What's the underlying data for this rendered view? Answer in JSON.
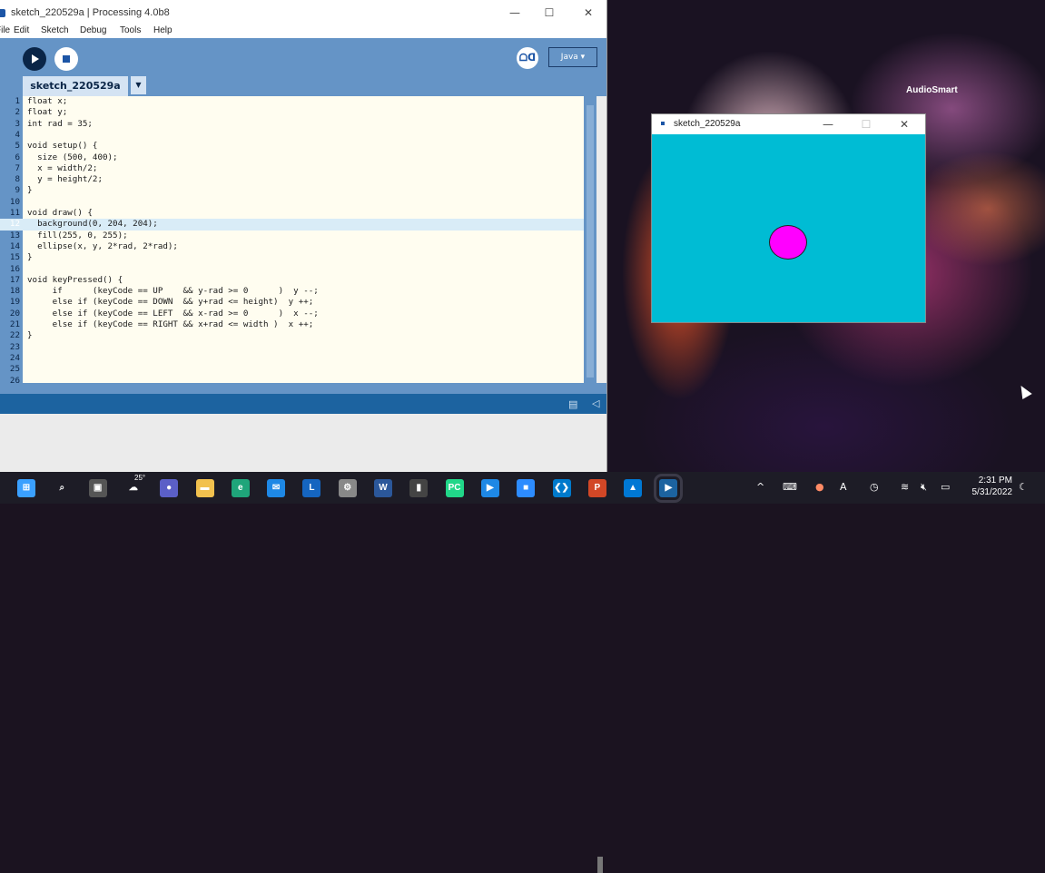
{
  "ide": {
    "title": "sketch_220529a | Processing 4.0b8",
    "menu": [
      "File",
      "Edit",
      "Sketch",
      "Debug",
      "Tools",
      "Help"
    ],
    "mode": "Java ▾",
    "debug_label": "ᗝᗡ",
    "tab_name": "sketch_220529a",
    "tab_menu": "▼"
  },
  "code": [
    {
      "n": "1",
      "t": "float x;"
    },
    {
      "n": "2",
      "t": "float y;"
    },
    {
      "n": "3",
      "t": "int rad = 35;"
    },
    {
      "n": "4",
      "t": ""
    },
    {
      "n": "5",
      "t": "void setup() {"
    },
    {
      "n": "6",
      "t": "  size (500, 400);"
    },
    {
      "n": "7",
      "t": "  x = width/2;"
    },
    {
      "n": "8",
      "t": "  y = height/2;"
    },
    {
      "n": "9",
      "t": "}"
    },
    {
      "n": "10",
      "t": ""
    },
    {
      "n": "11",
      "t": "void draw() {"
    },
    {
      "n": "12",
      "t": "  background(0, 204, 204);"
    },
    {
      "n": "13",
      "t": "  fill(255, 0, 255);"
    },
    {
      "n": "14",
      "t": "  ellipse(x, y, 2*rad, 2*rad);"
    },
    {
      "n": "15",
      "t": "}"
    },
    {
      "n": "16",
      "t": ""
    },
    {
      "n": "17",
      "t": "void keyPressed() {"
    },
    {
      "n": "18",
      "t": "     if      (keyCode == UP    && y-rad >= 0      )  y --;"
    },
    {
      "n": "19",
      "t": "     else if (keyCode == DOWN  && y+rad <= height)  y ++;"
    },
    {
      "n": "20",
      "t": "     else if (keyCode == LEFT  && x-rad >= 0      )  x --;"
    },
    {
      "n": "21",
      "t": "     else if (keyCode == RIGHT && x+rad <= width )  x ++;"
    },
    {
      "n": "22",
      "t": "}"
    },
    {
      "n": "23",
      "t": ""
    },
    {
      "n": "24",
      "t": ""
    },
    {
      "n": "25",
      "t": ""
    },
    {
      "n": "26",
      "t": ""
    }
  ],
  "highlighted_line": "12",
  "sketch_window": {
    "title": "sketch_220529a",
    "background_color": "#00bcd4",
    "ellipse_color": "#ff00ff"
  },
  "desktop": {
    "widget_label": "AudioSmart"
  },
  "taskbar": {
    "weather": "25°",
    "apps": [
      "windows-start",
      "search",
      "task-view",
      "weather",
      "chat",
      "file-explorer",
      "edge",
      "mail",
      "l-app",
      "settings",
      "word",
      "terminal",
      "pycharm",
      "media",
      "zoom",
      "vscode",
      "powerpoint",
      "photos",
      "processing"
    ],
    "time": "2:31 PM",
    "date": "5/31/2022"
  }
}
